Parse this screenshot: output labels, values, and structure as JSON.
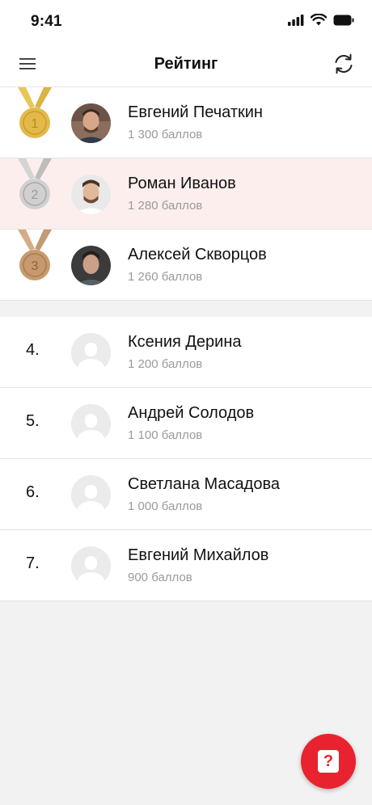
{
  "status_bar": {
    "time": "9:41"
  },
  "nav": {
    "title": "Рейтинг"
  },
  "top_players": [
    {
      "medal": "1",
      "name": "Евгений Печаткин",
      "score": "1 300 баллов"
    },
    {
      "medal": "2",
      "name": "Роман Иванов",
      "score": "1 280 баллов"
    },
    {
      "medal": "3",
      "name": "Алексей Скворцов",
      "score": "1 260 баллов"
    }
  ],
  "other_players": [
    {
      "rank": "4.",
      "name": "Ксения Дерина",
      "score": "1 200 баллов"
    },
    {
      "rank": "5.",
      "name": "Андрей Солодов",
      "score": "1 100 баллов"
    },
    {
      "rank": "6.",
      "name": "Светлана Масадова",
      "score": "1 000 баллов"
    },
    {
      "rank": "7.",
      "name": "Евгений Михайлов",
      "score": "900 баллов"
    }
  ],
  "fab": {
    "glyph": "?"
  },
  "colors": {
    "accent": "#e8232f",
    "highlight_row": "#fdeeee",
    "gold": "#e3b94a",
    "silver": "#c9c9c9",
    "bronze": "#c79a6e"
  },
  "icons": [
    "menu-icon",
    "refresh-icon",
    "signal-icon",
    "wifi-icon",
    "battery-icon",
    "help-icon"
  ]
}
